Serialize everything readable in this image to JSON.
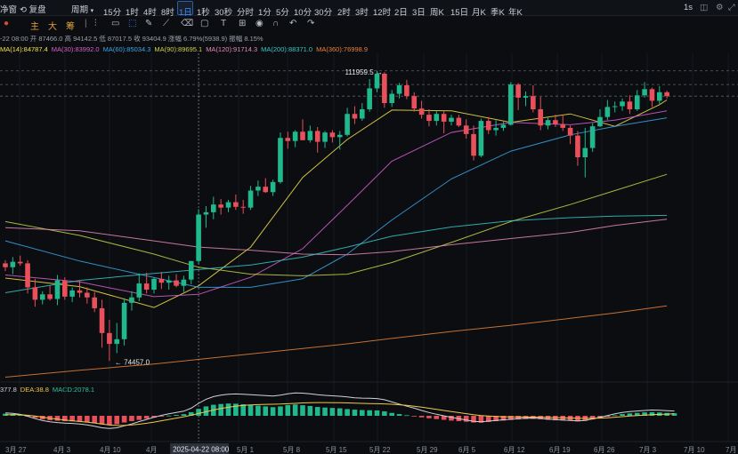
{
  "toolbar": {
    "left_cut": "净窗",
    "restore": "复盘",
    "period": "周期",
    "intervals": [
      "15分",
      "1时",
      "4时",
      "8时",
      "1日",
      "1秒",
      "30秒",
      "分时",
      "1分",
      "5分",
      "10分",
      "30分",
      "2时",
      "3时",
      "12时",
      "2日",
      "3日",
      "周K",
      "15日",
      "月K",
      "季K",
      "年K"
    ],
    "active_interval": "1日",
    "right_interval": "1s"
  },
  "tools": {
    "main_label": "主",
    "big_label": "大",
    "chip_label": "筹"
  },
  "info": {
    "ohlc_line": "-22 08:00  开 87466.0  高 94142.5  低 87017.5  收 93404.9  涨幅 6.79%(5938.9)  振幅 8.15%",
    "ma_items": [
      {
        "label": "MA(14):84787.4",
        "color": "#f5e14a"
      },
      {
        "label": "MA(30):83992.0",
        "color": "#d85fd0"
      },
      {
        "label": "MA(60):85034.3",
        "color": "#3aa6e8"
      },
      {
        "label": "MA(90):89695.1",
        "color": "#c8d24b"
      },
      {
        "label": "MA(120):91714.3",
        "color": "#e68ab8"
      },
      {
        "label": "MA(200):88371.0",
        "color": "#39c6c4"
      },
      {
        "label": "MA(360):76998.9",
        "color": "#e9813a"
      }
    ],
    "macd_items": [
      {
        "label": "377.8",
        "color": "#cfd3dc"
      },
      {
        "label": "DEA:38.8",
        "color": "#f0c94a"
      },
      {
        "label": "MACD:2078.1",
        "color": "#29c3a6"
      }
    ]
  },
  "annotations": {
    "high": "111959.5",
    "low": "74457.0",
    "crosshair_date": "2025-04-22 08:00"
  },
  "x_ticks": [
    "3月 27",
    "4月 3",
    "4月 10",
    "4月",
    "5月 1",
    "5月 8",
    "5月 15",
    "5月 22",
    "5月 29",
    "6月 5",
    "6月 12",
    "6月 19",
    "6月 26",
    "7月 3",
    "7月 10",
    "7月"
  ],
  "colors": {
    "up": "#1fb98d",
    "down": "#e8505b",
    "bg": "#0b0d10",
    "accent": "#3d8bfd"
  },
  "chart_data": {
    "type": "candlestick",
    "title": "",
    "period": "1日",
    "ylim": [
      72000,
      114000
    ],
    "x_ticks": [
      "3月 27",
      "4月 3",
      "4月 10",
      "4月",
      "5月 1",
      "5月 8",
      "5月 15",
      "5月 22",
      "5月 29",
      "6月 5",
      "6月 12",
      "6月 19",
      "6月 26",
      "7月 3",
      "7月 10",
      "7月"
    ],
    "candles_ohlc": [
      [
        87100,
        87500,
        86100,
        86600
      ],
      [
        86600,
        87900,
        85700,
        87300
      ],
      [
        87300,
        88100,
        86800,
        87100
      ],
      [
        87100,
        87500,
        83200,
        84000
      ],
      [
        84000,
        85100,
        81500,
        82400
      ],
      [
        82400,
        83500,
        81800,
        83100
      ],
      [
        83100,
        84200,
        82300,
        82500
      ],
      [
        82500,
        85600,
        81700,
        84900
      ],
      [
        84900,
        85300,
        82400,
        82800
      ],
      [
        82800,
        84000,
        82100,
        83600
      ],
      [
        83600,
        84900,
        82700,
        83300
      ],
      [
        83300,
        84000,
        81900,
        82700
      ],
      [
        82700,
        83400,
        80800,
        81300
      ],
      [
        81300,
        82400,
        76200,
        78100
      ],
      [
        78100,
        79800,
        74500,
        76700
      ],
      [
        76700,
        79400,
        75500,
        77300
      ],
      [
        77300,
        82600,
        76500,
        82000
      ],
      [
        82000,
        83500,
        81000,
        82700
      ],
      [
        82700,
        85800,
        82200,
        84500
      ],
      [
        84500,
        85900,
        83200,
        83700
      ],
      [
        83700,
        85300,
        83200,
        85100
      ],
      [
        85100,
        86000,
        83800,
        84600
      ],
      [
        84600,
        85500,
        83700,
        84900
      ],
      [
        84900,
        85700,
        84000,
        84200
      ],
      [
        84200,
        85500,
        83400,
        85000
      ],
      [
        85000,
        87400,
        84400,
        87400
      ],
      [
        87400,
        94100,
        87000,
        93400
      ],
      [
        93400,
        94500,
        91700,
        93700
      ],
      [
        93700,
        95700,
        92800,
        94700
      ],
      [
        94700,
        95400,
        93400,
        94300
      ],
      [
        94300,
        95300,
        93700,
        95000
      ],
      [
        95000,
        96000,
        94000,
        94400
      ],
      [
        94400,
        95300,
        93500,
        94300
      ],
      [
        94300,
        97100,
        94000,
        96500
      ],
      [
        96500,
        97800,
        95800,
        97000
      ],
      [
        97000,
        98100,
        96200,
        96300
      ],
      [
        96300,
        97900,
        95800,
        97600
      ],
      [
        97600,
        104000,
        97400,
        103300
      ],
      [
        103300,
        104100,
        101900,
        102900
      ],
      [
        102900,
        104300,
        102100,
        104100
      ],
      [
        104100,
        105700,
        103200,
        103000
      ],
      [
        103000,
        104900,
        102700,
        104200
      ],
      [
        104200,
        104700,
        101400,
        102800
      ],
      [
        102800,
        104200,
        102000,
        104000
      ],
      [
        104000,
        104300,
        102700,
        103400
      ],
      [
        103400,
        104200,
        101800,
        103700
      ],
      [
        103700,
        107200,
        103500,
        106400
      ],
      [
        106400,
        107400,
        105100,
        105800
      ],
      [
        105800,
        107800,
        105500,
        107000
      ],
      [
        107000,
        110900,
        106700,
        109700
      ],
      [
        109700,
        111960,
        109200,
        111600
      ],
      [
        111600,
        111800,
        107200,
        107800
      ],
      [
        107800,
        109500,
        107300,
        109000
      ],
      [
        109000,
        110400,
        108400,
        110100
      ],
      [
        110100,
        110800,
        108300,
        108700
      ],
      [
        108700,
        109200,
        106700,
        107100
      ],
      [
        107100,
        108100,
        105800,
        106300
      ],
      [
        106300,
        107000,
        104800,
        105500
      ],
      [
        105500,
        106800,
        104900,
        106400
      ],
      [
        106400,
        106800,
        103900,
        105400
      ],
      [
        105400,
        106300,
        104900,
        105900
      ],
      [
        105900,
        106300,
        104700,
        104900
      ],
      [
        104900,
        105700,
        103200,
        103800
      ],
      [
        103800,
        104900,
        100400,
        101000
      ],
      [
        101000,
        105800,
        100800,
        105500
      ],
      [
        105500,
        106000,
        103800,
        104300
      ],
      [
        104300,
        105600,
        103600,
        104600
      ],
      [
        104600,
        105400,
        104200,
        105000
      ],
      [
        105000,
        110500,
        104900,
        110200
      ],
      [
        110200,
        110400,
        106900,
        108500
      ],
      [
        108500,
        109300,
        107400,
        108700
      ],
      [
        108700,
        110100,
        106600,
        107000
      ],
      [
        107000,
        108600,
        104300,
        104900
      ],
      [
        104900,
        106000,
        104400,
        105600
      ],
      [
        105600,
        106300,
        104700,
        105100
      ],
      [
        105100,
        106300,
        104200,
        104600
      ],
      [
        104600,
        104900,
        102500,
        103600
      ],
      [
        103600,
        104200,
        99700,
        100800
      ],
      [
        100800,
        104600,
        98200,
        102000
      ],
      [
        102000,
        105200,
        101500,
        104800
      ],
      [
        104800,
        107000,
        104700,
        106000
      ],
      [
        106000,
        108200,
        105600,
        107300
      ],
      [
        107300,
        108000,
        106600,
        107400
      ],
      [
        107400,
        108400,
        106800,
        108000
      ],
      [
        108000,
        108800,
        106400,
        107000
      ],
      [
        107000,
        109500,
        106800,
        108800
      ],
      [
        108800,
        110500,
        108500,
        109600
      ],
      [
        109600,
        109800,
        107300,
        108100
      ],
      [
        108100,
        110000,
        107700,
        109200
      ],
      [
        109200,
        109400,
        108400,
        108700
      ]
    ],
    "ma": [
      {
        "name": "MA(14)",
        "color": "#f5e14a",
        "values": [
          [
            0,
            85200
          ],
          [
            10,
            84100
          ],
          [
            20,
            81400
          ],
          [
            26,
            84200
          ],
          [
            33,
            89200
          ],
          [
            40,
            98200
          ],
          [
            46,
            103100
          ],
          [
            52,
            106900
          ],
          [
            60,
            106800
          ],
          [
            68,
            105300
          ],
          [
            76,
            106400
          ],
          [
            82,
            104800
          ],
          [
            88,
            107600
          ],
          [
            89,
            108200
          ]
        ]
      },
      {
        "name": "MA(30)",
        "color": "#d85fd0",
        "values": [
          [
            0,
            85600
          ],
          [
            10,
            84700
          ],
          [
            20,
            82800
          ],
          [
            26,
            83100
          ],
          [
            33,
            85300
          ],
          [
            40,
            89000
          ],
          [
            46,
            94600
          ],
          [
            52,
            100300
          ],
          [
            60,
            104000
          ],
          [
            68,
            105300
          ],
          [
            76,
            105000
          ],
          [
            82,
            105600
          ],
          [
            89,
            106800
          ]
        ]
      },
      {
        "name": "MA(60)",
        "color": "#3aa6e8",
        "values": [
          [
            0,
            90000
          ],
          [
            10,
            87400
          ],
          [
            18,
            85700
          ],
          [
            26,
            84000
          ],
          [
            33,
            84000
          ],
          [
            40,
            85100
          ],
          [
            46,
            88300
          ],
          [
            52,
            92700
          ],
          [
            60,
            98000
          ],
          [
            68,
            101600
          ],
          [
            76,
            103700
          ],
          [
            82,
            104800
          ],
          [
            89,
            105900
          ]
        ]
      },
      {
        "name": "MA(90)",
        "color": "#c8d24b",
        "values": [
          [
            0,
            92500
          ],
          [
            10,
            90700
          ],
          [
            20,
            88300
          ],
          [
            26,
            86600
          ],
          [
            33,
            85700
          ],
          [
            40,
            85500
          ],
          [
            46,
            85700
          ],
          [
            52,
            87200
          ],
          [
            60,
            89800
          ],
          [
            68,
            92500
          ],
          [
            76,
            94700
          ],
          [
            82,
            96500
          ],
          [
            89,
            98600
          ]
        ]
      },
      {
        "name": "MA(120)",
        "color": "#e68ab8",
        "values": [
          [
            0,
            91700
          ],
          [
            10,
            91300
          ],
          [
            20,
            90000
          ],
          [
            26,
            89200
          ],
          [
            33,
            88800
          ],
          [
            40,
            88300
          ],
          [
            46,
            88200
          ],
          [
            52,
            88600
          ],
          [
            60,
            89500
          ],
          [
            68,
            90300
          ],
          [
            76,
            91100
          ],
          [
            82,
            92000
          ],
          [
            89,
            92800
          ]
        ]
      },
      {
        "name": "MA(200)",
        "color": "#39c6c4",
        "values": [
          [
            0,
            83300
          ],
          [
            10,
            84900
          ],
          [
            20,
            85800
          ],
          [
            26,
            86300
          ],
          [
            33,
            86900
          ],
          [
            40,
            87900
          ],
          [
            46,
            89200
          ],
          [
            52,
            90600
          ],
          [
            60,
            91800
          ],
          [
            68,
            92600
          ],
          [
            76,
            93000
          ],
          [
            82,
            93200
          ],
          [
            89,
            93300
          ]
        ]
      },
      {
        "name": "MA(360)",
        "color": "#e9813a",
        "values": [
          [
            0,
            72400
          ],
          [
            10,
            73300
          ],
          [
            20,
            74100
          ],
          [
            26,
            74700
          ],
          [
            33,
            75400
          ],
          [
            40,
            76100
          ],
          [
            46,
            76700
          ],
          [
            52,
            77400
          ],
          [
            60,
            78300
          ],
          [
            68,
            79100
          ],
          [
            76,
            80000
          ],
          [
            82,
            80700
          ],
          [
            89,
            81600
          ]
        ]
      }
    ],
    "price_lines": [
      111959.5,
      110200,
      108700
    ],
    "annotations": [
      {
        "text": "111959.5",
        "index": 50,
        "value": 111959.5
      },
      {
        "text": "74457.0",
        "index": 14,
        "value": 74457.0
      }
    ],
    "macd_hist": [
      220,
      180,
      90,
      -60,
      -220,
      -380,
      -470,
      -520,
      -560,
      -580,
      -620,
      -700,
      -780,
      -900,
      -950,
      -880,
      -700,
      -560,
      -430,
      -300,
      -180,
      -80,
      20,
      90,
      170,
      380,
      720,
      980,
      1150,
      1230,
      1280,
      1260,
      1200,
      1120,
      1060,
      980,
      900,
      980,
      1120,
      1180,
      1100,
      1020,
      920,
      860,
      820,
      780,
      700,
      640,
      600,
      580,
      560,
      460,
      300,
      180,
      60,
      -40,
      -160,
      -260,
      -340,
      -420,
      -500,
      -560,
      -620,
      -700,
      -720,
      -640,
      -560,
      -500,
      -430,
      -380,
      -340,
      -320,
      -360,
      -420,
      -470,
      -490,
      -510,
      -580,
      -520,
      -380,
      -240,
      -100,
      60,
      180,
      250,
      300,
      360,
      380,
      350,
      300,
      270
    ],
    "macd_dif": [
      300,
      250,
      150,
      -50,
      -300,
      -500,
      -620,
      -700,
      -760,
      -800,
      -850,
      -950,
      -1080,
      -1250,
      -1320,
      -1250,
      -1050,
      -850,
      -600,
      -380,
      -160,
      50,
      200,
      340,
      480,
      800,
      1300,
      1720,
      2000,
      2150,
      2250,
      2280,
      2250,
      2200,
      2150,
      2100,
      2060,
      2150,
      2300,
      2380,
      2360,
      2300,
      2200,
      2130,
      2080,
      2040,
      1960,
      1880,
      1840,
      1820,
      1800,
      1680,
      1440,
      1220,
      1000,
      800,
      560,
      340,
      160,
      0,
      -160,
      -300,
      -440,
      -580,
      -620,
      -560,
      -480,
      -420,
      -360,
      -300,
      -260,
      -240,
      -280,
      -340,
      -400,
      -440,
      -480,
      -540,
      -480,
      -320,
      -160,
      20,
      200,
      340,
      440,
      500,
      560,
      600,
      580,
      540,
      500
    ],
    "macd_dea": [
      100,
      120,
      110,
      60,
      -30,
      -140,
      -250,
      -350,
      -440,
      -520,
      -590,
      -660,
      -750,
      -860,
      -960,
      -1010,
      -1000,
      -950,
      -880,
      -780,
      -660,
      -520,
      -380,
      -240,
      -100,
      60,
      240,
      420,
      600,
      760,
      890,
      1000,
      1080,
      1140,
      1170,
      1190,
      1200,
      1220,
      1260,
      1300,
      1340,
      1360,
      1380,
      1380,
      1370,
      1360,
      1340,
      1320,
      1300,
      1280,
      1260,
      1240,
      1200,
      1150,
      1080,
      1000,
      900,
      790,
      680,
      560,
      440,
      330,
      220,
      110,
      30,
      -30,
      -70,
      -100,
      -120,
      -130,
      -130,
      -140,
      -150,
      -170,
      -190,
      -210,
      -230,
      -260,
      -270,
      -260,
      -240,
      -200,
      -150,
      -90,
      -30,
      20,
      70,
      110,
      150,
      180,
      200
    ]
  }
}
